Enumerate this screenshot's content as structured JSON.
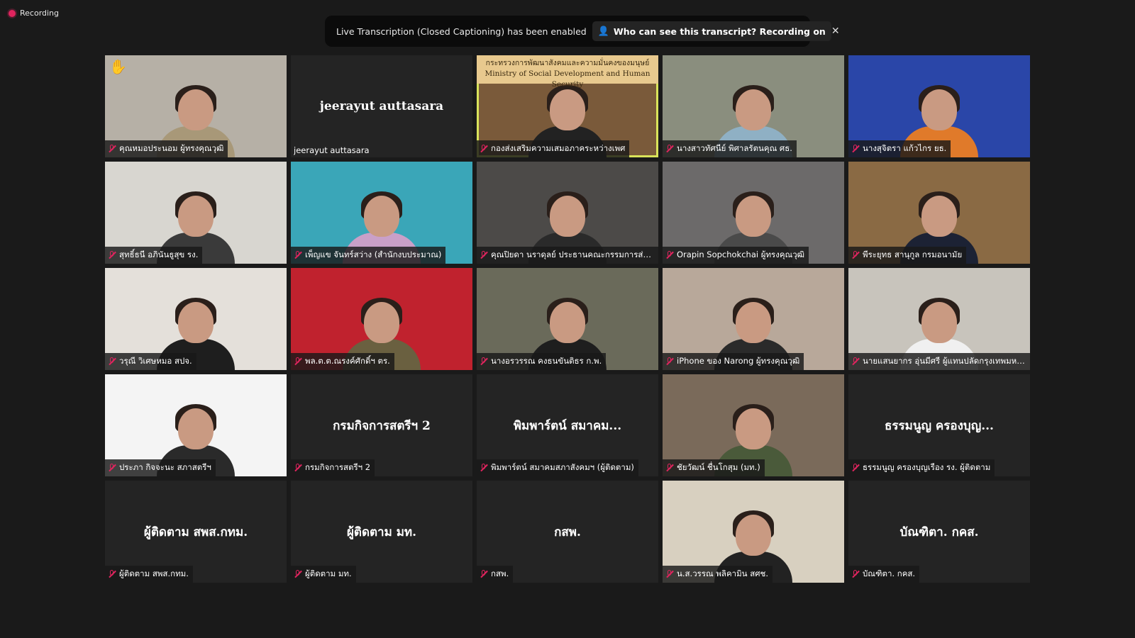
{
  "recording": {
    "label": "Recording"
  },
  "banner": {
    "message": "Live Transcription (Closed Captioning) has been enabled",
    "pill": "Who can see this transcript? Recording on",
    "close": "✕"
  },
  "tiles": [
    {
      "label": "คุณหมอประนอม ผู้ทรงคุณวุฒิ",
      "center": "",
      "hand": "✋",
      "bg": "#b6b0a6",
      "body": "#a89878"
    },
    {
      "label": "jeerayut auttasara",
      "center": "jeerayut auttasara",
      "bg": "#242424"
    },
    {
      "label": "กองส่งเสริมความเสมอภาคระหว่างเพศ",
      "center": "",
      "sign1": "กระทรวงการพัฒนาสังคมและความมั่นคงของมนุษย์",
      "sign2": "Ministry of Social Development and Human Security",
      "bg": "#7a5a3a",
      "body": "#222"
    },
    {
      "label": "นางสาวทัศนีย์ พิศาลรัตนคุณ ศธ.",
      "center": "",
      "bg": "#8a8e7e",
      "body": "#8fb0c4"
    },
    {
      "label": "นางสุจิตรา แก้วไกร ยธ.",
      "center": "",
      "bg": "#2a46a8",
      "body": "#e07a2a"
    },
    {
      "label": "สุทธิ์ธนี อภินันธูสุข รง.",
      "center": "",
      "bg": "#d8d6d0",
      "body": "#3a3a3a"
    },
    {
      "label": "เพ็ญแข จันทร์สว่าง (สำนักงบประมาณ)",
      "center": "",
      "bg": "#3aa6b8",
      "body": "#c9a0c8"
    },
    {
      "label": "คุณปิยดา นราดุลย์ ประธานคณะกรรมการส่ง...",
      "center": "",
      "bg": "#4c4a48",
      "body": "#2a2a2a"
    },
    {
      "label": "Orapin Sopchokchai ผู้ทรงคุณวุฒิ",
      "center": "",
      "bg": "#6c6a6a",
      "body": "#4a4a4a"
    },
    {
      "label": "พีระยุทธ สานุกูล กรมอนามัย",
      "center": "",
      "bg": "#8a6a44",
      "body": "#1c2234"
    },
    {
      "label": "วรุณี วิเศษหมอ สปจ.",
      "center": "",
      "bg": "#e4e0da",
      "body": "#1e1e1e"
    },
    {
      "label": "พล.ต.ต.ณรงค์ศักดิ์ฯ ตร.",
      "center": "",
      "bg": "#c0222e",
      "body": "#6a6040"
    },
    {
      "label": "นางอรวรรณ คงธนขันติธร ก.พ.",
      "center": "",
      "bg": "#6a6a5a",
      "body": "#1e1e1e"
    },
    {
      "label": "iPhone ของ Narong ผู้ทรงคุณวุฒิ",
      "center": "",
      "bg": "#b8a89a",
      "body": "#2a2a2a"
    },
    {
      "label": "นายแสนยากร อุ่นมีศรี ผู้แทนปลัดกรุงเทพมหา...",
      "center": "",
      "bg": "#c8c4bc",
      "body": "#f0f0f0"
    },
    {
      "label": "ประภา กิจจะนะ สภาสตรีฯ",
      "center": "",
      "bg": "#f4f4f4",
      "body": "#2a2a2a"
    },
    {
      "label": "กรมกิจการสตรีฯ 2",
      "center": "กรมกิจการสตรีฯ 2",
      "bg": "#242424"
    },
    {
      "label": "พิมพาร์ตน์ สมาคมสภาสังคมฯ (ผู้ติดตาม)",
      "center": "พิมพาร์ตน์ สมาคม...",
      "bg": "#242424"
    },
    {
      "label": "ชัยวัฒน์ ชื่นโกสุม (มท.)",
      "center": "",
      "bg": "#7a6a5a",
      "body": "#4a5a3a"
    },
    {
      "label": "ธรรมนูญ ครองบุญเรือง รง. ผู้ติดตาม",
      "center": "ธรรมนูญ ครองบุญ...",
      "bg": "#242424"
    },
    {
      "label": "ผู้ติดตาม สพส.กทม.",
      "center": "ผู้ติดตาม สพส.กทม.",
      "bg": "#242424"
    },
    {
      "label": "ผู้ติดตาม มท.",
      "center": "ผู้ติดตาม มท.",
      "bg": "#242424"
    },
    {
      "label": "กสพ.",
      "center": "กสพ.",
      "bg": "#242424"
    },
    {
      "label": "น.ส.วรรณ พลิคามิน สศช.",
      "center": "",
      "bg": "#d8d0c0",
      "body": "#222"
    },
    {
      "label": "บัณฑิตา. กคส.",
      "center": "บัณฑิตา. กคส.",
      "bg": "#242424"
    }
  ]
}
